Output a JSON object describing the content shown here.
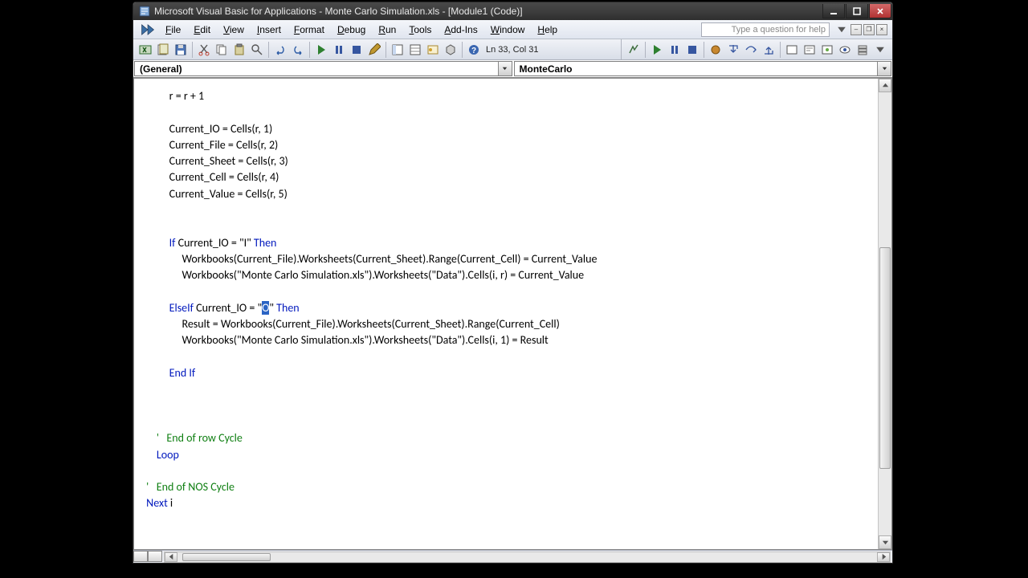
{
  "window": {
    "title": "Microsoft Visual Basic for Applications - Monte Carlo Simulation.xls - [Module1 (Code)]"
  },
  "menubar": {
    "items": [
      "File",
      "Edit",
      "View",
      "Insert",
      "Format",
      "Debug",
      "Run",
      "Tools",
      "Add-Ins",
      "Window",
      "Help"
    ],
    "help_placeholder": "Type a question for help"
  },
  "toolbar": {
    "cursor": "Ln 33, Col 31"
  },
  "combos": {
    "left": "(General)",
    "right": "MonteCarlo"
  },
  "code": {
    "lines": [
      {
        "indent": 3,
        "segs": [
          {
            "t": "r = r + 1"
          }
        ]
      },
      {
        "indent": 3,
        "segs": []
      },
      {
        "indent": 3,
        "segs": [
          {
            "t": "Current_IO = Cells(r, 1)"
          }
        ]
      },
      {
        "indent": 3,
        "segs": [
          {
            "t": "Current_File = Cells(r, 2)"
          }
        ]
      },
      {
        "indent": 3,
        "segs": [
          {
            "t": "Current_Sheet = Cells(r, 3)"
          }
        ]
      },
      {
        "indent": 3,
        "segs": [
          {
            "t": "Current_Cell = Cells(r, 4)"
          }
        ]
      },
      {
        "indent": 3,
        "segs": [
          {
            "t": "Current_Value = Cells(r, 5)"
          }
        ]
      },
      {
        "indent": 3,
        "segs": []
      },
      {
        "indent": 3,
        "segs": []
      },
      {
        "indent": 3,
        "segs": [
          {
            "t": "If",
            "c": "kw"
          },
          {
            "t": " Current_IO = \"I\" "
          },
          {
            "t": "Then",
            "c": "kw"
          }
        ]
      },
      {
        "indent": 4,
        "segs": [
          {
            "t": "Workbooks(Current_File).Worksheets(Current_Sheet).Range(Current_Cell) = Current_Value"
          }
        ]
      },
      {
        "indent": 4,
        "segs": [
          {
            "t": "Workbooks(\"Monte Carlo Simulation.xls\").Worksheets(\"Data\").Cells(i, r) = Current_Value"
          }
        ]
      },
      {
        "indent": 3,
        "segs": []
      },
      {
        "indent": 3,
        "segs": [
          {
            "t": "ElseIf",
            "c": "kw"
          },
          {
            "t": " Current_IO = \""
          },
          {
            "t": "O",
            "c": "sel"
          },
          {
            "t": "\" "
          },
          {
            "t": "Then",
            "c": "kw"
          }
        ]
      },
      {
        "indent": 4,
        "segs": [
          {
            "t": "Result = Workbooks(Current_File).Worksheets(Current_Sheet).Range(Current_Cell)"
          }
        ]
      },
      {
        "indent": 4,
        "segs": [
          {
            "t": "Workbooks(\"Monte Carlo Simulation.xls\").Worksheets(\"Data\").Cells(i, 1) = Result"
          }
        ]
      },
      {
        "indent": 3,
        "segs": []
      },
      {
        "indent": 3,
        "segs": [
          {
            "t": "End If",
            "c": "kw"
          }
        ]
      },
      {
        "indent": 3,
        "segs": []
      },
      {
        "indent": 3,
        "segs": []
      },
      {
        "indent": 3,
        "segs": []
      },
      {
        "indent": 2,
        "segs": [
          {
            "t": "'   End of row Cycle",
            "c": "cm"
          }
        ]
      },
      {
        "indent": 2,
        "segs": [
          {
            "t": "Loop",
            "c": "kw"
          }
        ]
      },
      {
        "indent": 2,
        "segs": []
      },
      {
        "indent": 1,
        "segs": [
          {
            "t": "'   End of NOS Cycle",
            "c": "cm"
          }
        ]
      },
      {
        "indent": 1,
        "segs": [
          {
            "t": "Next",
            "c": "kw"
          },
          {
            "t": " i"
          }
        ]
      }
    ]
  }
}
